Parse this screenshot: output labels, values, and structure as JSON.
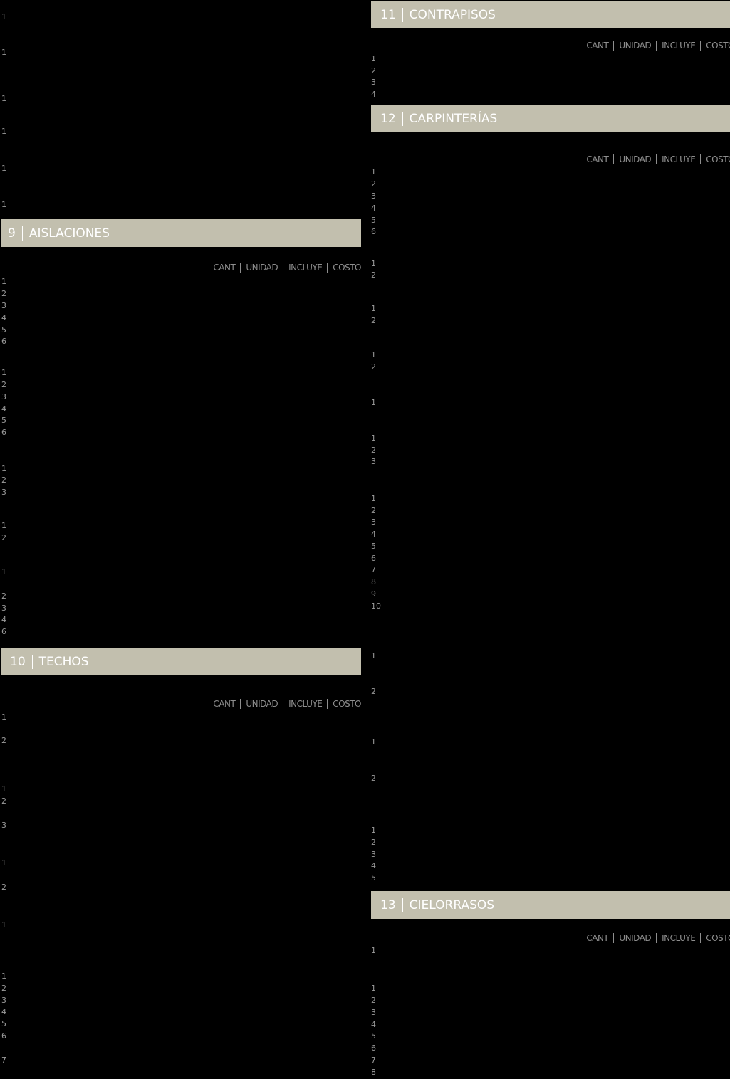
{
  "column_headers": {
    "cant": "CANT",
    "unidad": "UNIDAD",
    "incluye": "INCLUYE",
    "costo": "COSTO",
    "costo_cut": "COSTO"
  },
  "sections": {
    "aislaciones": {
      "number": "9",
      "title": "AISLACIONES"
    },
    "techos": {
      "number": "10",
      "title": "TECHOS"
    },
    "contrapisos": {
      "number": "11",
      "title": "CONTRAPISOS"
    },
    "carpinterias": {
      "number": "12",
      "title": "CARPINTERÍAS"
    },
    "cielorrasos": {
      "number": "13",
      "title": "CIELORRASOS"
    }
  },
  "left_rows": {
    "top": [
      "1",
      "1",
      "1",
      "1",
      "1",
      "1"
    ],
    "aislaciones": [
      "1",
      "2",
      "3",
      "4",
      "5",
      "6",
      "1",
      "2",
      "3",
      "4",
      "5",
      "6",
      "1",
      "2",
      "3",
      "1",
      "2",
      "1",
      "2",
      "3",
      "4",
      "6"
    ],
    "techos": [
      "1",
      "2",
      "1",
      "2",
      "3",
      "1",
      "2",
      "1",
      "1",
      "2",
      "3",
      "4",
      "5",
      "6",
      "7"
    ]
  },
  "right_rows": {
    "contrapisos": [
      "1",
      "2",
      "3",
      "4"
    ],
    "carpinterias": [
      "1",
      "2",
      "3",
      "4",
      "5",
      "6",
      "1",
      "2",
      "1",
      "2",
      "1",
      "2",
      "1",
      "1",
      "2",
      "3",
      "1",
      "2",
      "3",
      "4",
      "5",
      "6",
      "7",
      "8",
      "9",
      "10",
      "1",
      "2",
      "1",
      "2",
      "1",
      "2",
      "3",
      "4",
      "5"
    ],
    "cielorrasos": [
      "1",
      "1",
      "2",
      "3",
      "4",
      "5",
      "6",
      "7",
      "8"
    ]
  }
}
